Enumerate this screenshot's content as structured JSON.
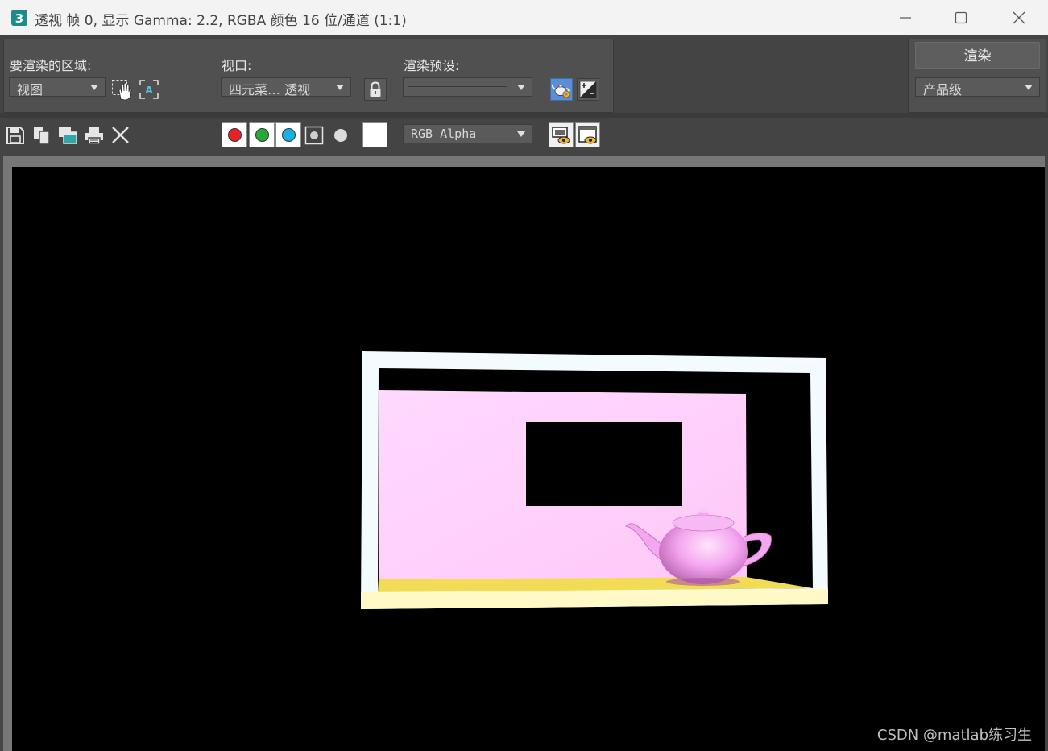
{
  "window": {
    "title": "透视 帧 0, 显示 Gamma: 2.2, RGBA 颜色 16 位/通道 (1:1)",
    "app_icon": "3ds-max-icon",
    "app_icon_label": "3",
    "controls": [
      "minimize-icon",
      "maximize-icon",
      "close-icon"
    ]
  },
  "render_panel": {
    "area_label": "要渲染的区域:",
    "area_value": "视图",
    "viewport_label": "视口:",
    "viewport_value": "四元菜… 透视",
    "preset_label": "渲染预设:",
    "preset_value": "",
    "render_button": "渲染",
    "quality_value": "产品级"
  },
  "toolbar": {
    "icons": [
      "save-icon",
      "copy-icon",
      "clone-window-icon",
      "print-icon",
      "clear-icon"
    ],
    "channels": {
      "red": "#e8202a",
      "green": "#2aa83a",
      "blue": "#1ab0e6"
    },
    "channel_display_value": "RGB Alpha"
  },
  "viewport": {
    "background": "#000000",
    "scene_colors": {
      "frame": "#f4fbff",
      "wall": "#ffd6ff",
      "floor": "#f2dc56",
      "floor_edge": "#fff9c8",
      "teapot": "#f5a6f0"
    },
    "watermark": "CSDN @matlab练习生"
  }
}
